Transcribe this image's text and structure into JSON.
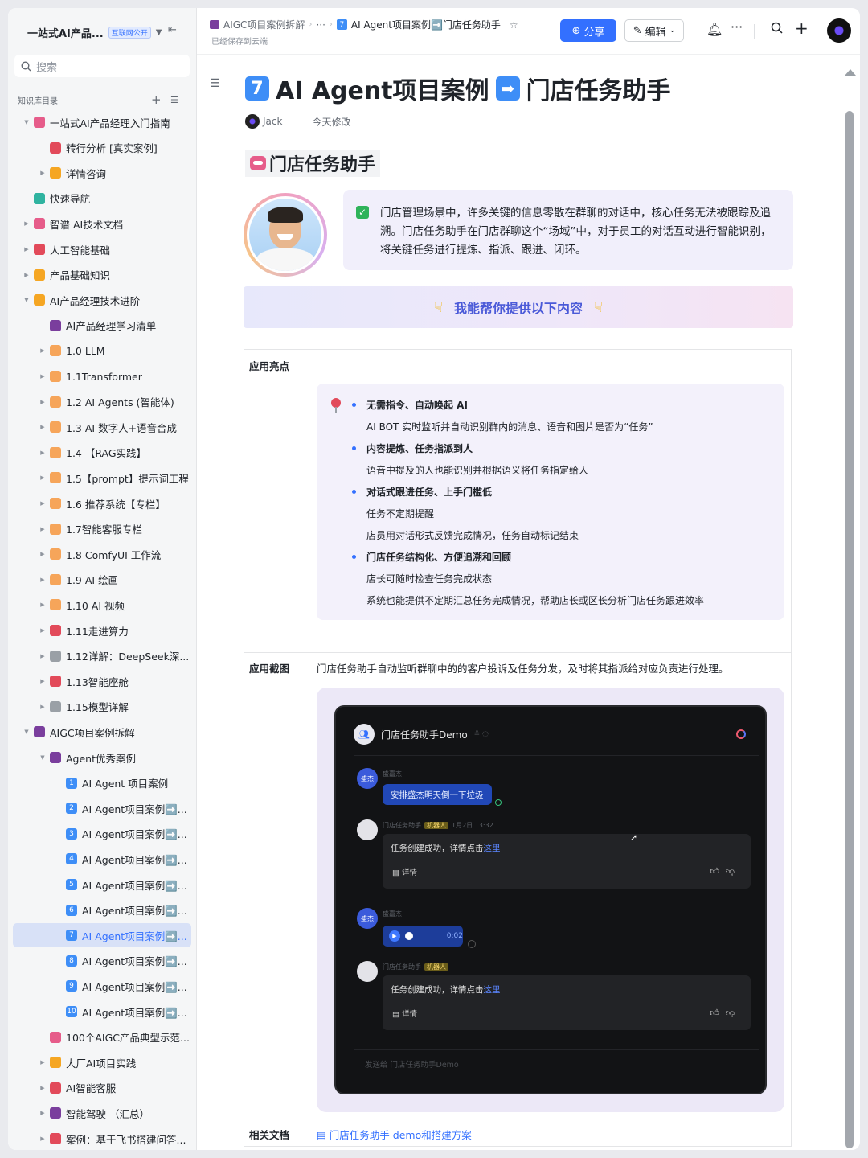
{
  "sidebar": {
    "space_title": "一站式AI产品...",
    "badge": "互联网公开",
    "search_placeholder": "搜索",
    "section_label": "知识库目录",
    "items": [
      {
        "label": "一站式AI产品经理入门指南",
        "depth": 0,
        "arrow": "▼",
        "color": "#e65c8a"
      },
      {
        "label": "转行分析 [真实案例]",
        "depth": 1,
        "arrow": "",
        "color": "#e24a5a"
      },
      {
        "label": "详情咨询",
        "depth": 1,
        "arrow": "▶",
        "color": "#f5a623"
      },
      {
        "label": "快速导航",
        "depth": 0,
        "arrow": "",
        "color": "#2fb3a0"
      },
      {
        "label": "智谱 AI技术文档",
        "depth": 0,
        "arrow": "▶",
        "color": "#e65c8a"
      },
      {
        "label": "人工智能基础",
        "depth": 0,
        "arrow": "▶",
        "color": "#e24a5a"
      },
      {
        "label": "产品基础知识",
        "depth": 0,
        "arrow": "▶",
        "color": "#f5a623"
      },
      {
        "label": "AI产品经理技术进阶",
        "depth": 0,
        "arrow": "▼",
        "color": "#f5a623"
      },
      {
        "label": "AI产品经理学习清单",
        "depth": 1,
        "arrow": "",
        "color": "#7a3e9d"
      },
      {
        "label": "1.0 LLM",
        "depth": 1,
        "arrow": "▶",
        "color": "#f6a55a"
      },
      {
        "label": "1.1Transformer",
        "depth": 1,
        "arrow": "▶",
        "color": "#f6a55a"
      },
      {
        "label": "1.2 AI Agents (智能体)",
        "depth": 1,
        "arrow": "▶",
        "color": "#f6a55a"
      },
      {
        "label": "1.3 AI 数字人+语音合成",
        "depth": 1,
        "arrow": "▶",
        "color": "#f6a55a"
      },
      {
        "label": "1.4 【RAG实践】",
        "depth": 1,
        "arrow": "▶",
        "color": "#f6a55a"
      },
      {
        "label": "1.5【prompt】提示词工程",
        "depth": 1,
        "arrow": "▶",
        "color": "#f6a55a"
      },
      {
        "label": "1.6 推荐系统【专栏】",
        "depth": 1,
        "arrow": "▶",
        "color": "#f6a55a"
      },
      {
        "label": "1.7智能客服专栏",
        "depth": 1,
        "arrow": "▶",
        "color": "#f6a55a"
      },
      {
        "label": "1.8 ComfyUI 工作流",
        "depth": 1,
        "arrow": "▶",
        "color": "#f6a55a"
      },
      {
        "label": "1.9 AI 绘画",
        "depth": 1,
        "arrow": "▶",
        "color": "#f6a55a"
      },
      {
        "label": "1.10 AI 视频",
        "depth": 1,
        "arrow": "▶",
        "color": "#f6a55a"
      },
      {
        "label": "1.11走进算力",
        "depth": 1,
        "arrow": "▶",
        "color": "#e24a5a"
      },
      {
        "label": "1.12详解：DeepSeek深...",
        "depth": 1,
        "arrow": "▶",
        "color": "#9aa0a6"
      },
      {
        "label": "1.13智能座舱",
        "depth": 1,
        "arrow": "▶",
        "color": "#e24a5a"
      },
      {
        "label": "1.15模型详解",
        "depth": 1,
        "arrow": "▶",
        "color": "#9aa0a6"
      },
      {
        "label": "AIGC项目案例拆解",
        "depth": 0,
        "arrow": "▼",
        "color": "#7a3e9d"
      },
      {
        "label": "Agent优秀案例",
        "depth": 1,
        "arrow": "▼",
        "color": "#7a3e9d"
      },
      {
        "label": "AI Agent 项目案例",
        "depth": 2,
        "arrow": "",
        "color": "#3e8ef7",
        "num": "1"
      },
      {
        "label": "AI Agent项目案例➡️...",
        "depth": 2,
        "arrow": "",
        "color": "#3e8ef7",
        "num": "2"
      },
      {
        "label": "AI Agent项目案例➡️...",
        "depth": 2,
        "arrow": "",
        "color": "#3e8ef7",
        "num": "3"
      },
      {
        "label": "AI Agent项目案例➡️...",
        "depth": 2,
        "arrow": "",
        "color": "#3e8ef7",
        "num": "4"
      },
      {
        "label": "AI Agent项目案例➡️...",
        "depth": 2,
        "arrow": "",
        "color": "#3e8ef7",
        "num": "5"
      },
      {
        "label": "AI Agent项目案例➡️...",
        "depth": 2,
        "arrow": "",
        "color": "#3e8ef7",
        "num": "6"
      },
      {
        "label": "AI Agent项目案例➡️...",
        "depth": 2,
        "arrow": "",
        "color": "#3e8ef7",
        "num": "7",
        "active": true
      },
      {
        "label": "AI Agent项目案例➡️...",
        "depth": 2,
        "arrow": "",
        "color": "#3e8ef7",
        "num": "8"
      },
      {
        "label": "AI Agent项目案例➡️...",
        "depth": 2,
        "arrow": "",
        "color": "#3e8ef7",
        "num": "9"
      },
      {
        "label": "AI Agent项目案例➡️...",
        "depth": 2,
        "arrow": "",
        "color": "#3e8ef7",
        "num": "10"
      },
      {
        "label": "100个AIGC产品典型示范...",
        "depth": 1,
        "arrow": "",
        "color": "#e65c8a"
      },
      {
        "label": "大厂AI项目实践",
        "depth": 1,
        "arrow": "▶",
        "color": "#f5a623"
      },
      {
        "label": "AI智能客服",
        "depth": 1,
        "arrow": "▶",
        "color": "#e24a5a"
      },
      {
        "label": "智能驾驶 （汇总）",
        "depth": 1,
        "arrow": "▶",
        "color": "#7a3e9d"
      },
      {
        "label": "案例：基于飞书搭建问答...",
        "depth": 1,
        "arrow": "▶",
        "color": "#e24a5a"
      }
    ]
  },
  "topbar": {
    "breadcrumb_root": "AIGC项目案例拆解",
    "breadcrumb_more": "···",
    "breadcrumb_num": "7",
    "breadcrumb_current": "AI Agent项目案例➡️门店任务助手",
    "saved_status": "已经保存到云端",
    "share_label": "分享",
    "edit_label": "编辑"
  },
  "doc": {
    "title_num": "7",
    "title_text": "AI Agent项目案例",
    "title_arrow": "➡",
    "title_tail": "门店任务助手",
    "author": "Jack",
    "modified": "今天修改",
    "heading": "门店任务助手",
    "intro": "门店管理场景中，许多关键的信息零散在群聊的对话中，核心任务无法被跟踪及追溯。门店任务助手在门店群聊这个“场域”中，对于员工的对话互动进行智能识别，将关键任务进行提炼、指派、跟进、闭环。",
    "banner_text": "我能帮你提供以下内容",
    "table": {
      "row1_header": "应用亮点",
      "highlights": [
        {
          "text": "无需指令、自动唤起 AI",
          "bold": true,
          "bullet": true
        },
        {
          "text": "AI BOT 实时监听并自动识别群内的消息、语音和图片是否为“任务”",
          "bold": false,
          "bullet": false
        },
        {
          "text": "内容提炼、任务指派到人",
          "bold": true,
          "bullet": true
        },
        {
          "text": "语音中提及的人也能识别并根据语义将任务指定给人",
          "bold": false,
          "bullet": false
        },
        {
          "text": "对话式跟进任务、上手门槛低",
          "bold": true,
          "bullet": true
        },
        {
          "text": "任务不定期提醒",
          "bold": false,
          "bullet": false
        },
        {
          "text": "店员用对话形式反馈完成情况，任务自动标记结束",
          "bold": false,
          "bullet": false
        },
        {
          "text": "门店任务结构化、方便追溯和回顾",
          "bold": true,
          "bullet": true
        },
        {
          "text": "店长可随时检查任务完成状态",
          "bold": false,
          "bullet": false
        },
        {
          "text": "系统也能提供不定期汇总任务完成情况，帮助店长或区长分析门店任务跟进效率",
          "bold": false,
          "bullet": false
        }
      ],
      "row2_header": "应用截图",
      "screenshot_desc": "门店任务助手自动监听群聊中的的客户投诉及任务分发，及时将其指派给对应负责进行处理。",
      "row3_header": "相关文档",
      "related_doc": "门店任务助手 demo和搭建方案"
    },
    "demo": {
      "group_name": "门店任务助手Demo",
      "user_avatar_label": "盛杰",
      "user_name": "盛嘉杰",
      "user_message": "安排盛杰明天倒一下垃圾",
      "bot_name": "门店任务助手",
      "bot_tag": "机器人",
      "bot_time": "1月2日 13:32",
      "bot_reply_prefix": "任务创建成功，详情点击",
      "bot_reply_link": "这里",
      "detail_label": "详情",
      "voice_duration": "0:02",
      "input_placeholder": "发送给 门店任务助手Demo"
    }
  }
}
